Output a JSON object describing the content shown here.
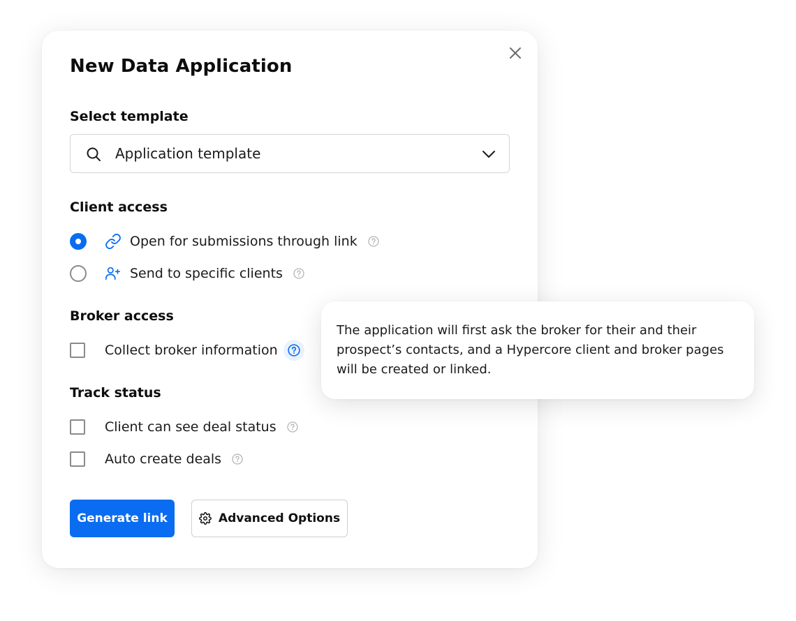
{
  "dialog": {
    "title": "New Data Application"
  },
  "template": {
    "label": "Select template",
    "selected_value": "Application template"
  },
  "client_access": {
    "label": "Client access",
    "options": [
      {
        "label": "Open for submissions through link",
        "selected": true,
        "icon": "link-icon"
      },
      {
        "label": "Send to specific clients",
        "selected": false,
        "icon": "user-plus-icon"
      }
    ]
  },
  "broker_access": {
    "label": "Broker access",
    "options": [
      {
        "label": "Collect broker information",
        "checked": false
      }
    ]
  },
  "track_status": {
    "label": "Track status",
    "options": [
      {
        "label": "Client can see deal status",
        "checked": false
      },
      {
        "label": "Auto create deals",
        "checked": false
      }
    ]
  },
  "actions": {
    "primary_label": "Generate link",
    "secondary_label": "Advanced Options"
  },
  "tooltip": {
    "text": "The application will first ask the broker for their and their prospect’s contacts, and a Hypercore client and broker pages will be created or linked."
  },
  "colors": {
    "accent": "#0a6cf0",
    "border": "#d4d4d4",
    "help_icon": "#b5b5b5"
  }
}
